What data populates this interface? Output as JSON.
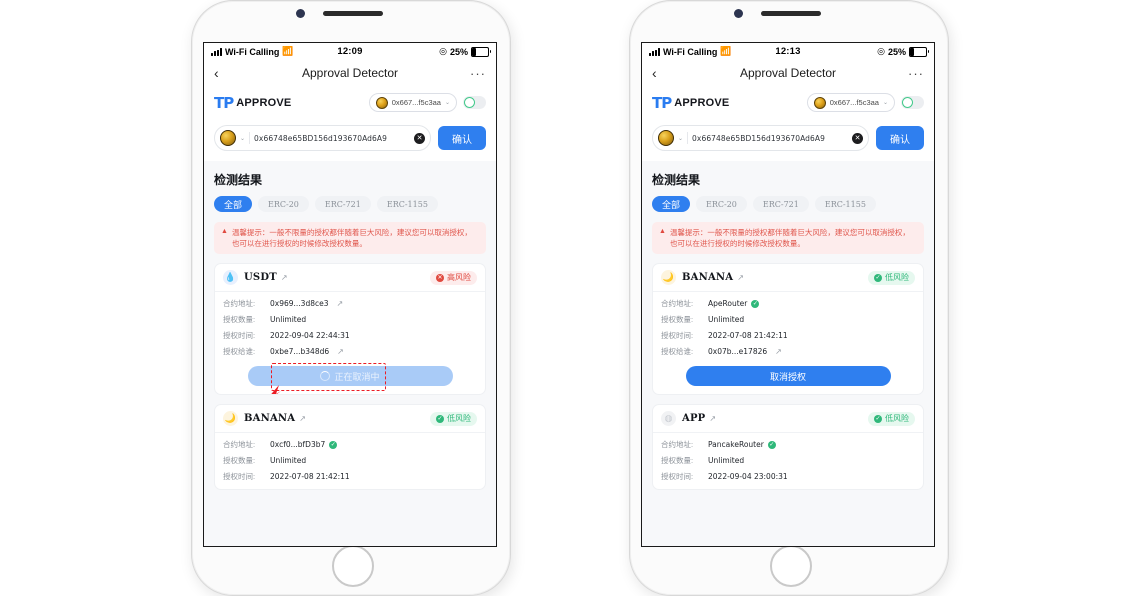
{
  "phones": [
    {
      "id": "left",
      "status": {
        "carrier": "Wi-Fi Calling",
        "time": "12:09",
        "battery": "25%"
      },
      "nav": {
        "back": "‹",
        "title": "Approval Detector",
        "more": "···"
      },
      "dapp": {
        "logo_mark": "TP",
        "logo_word": "APPROVE",
        "address_chip": "0x667...f5c3aa",
        "chevron": "⌄"
      },
      "address_bar": {
        "value": "0x66748e65BD156d193670Ad6A9",
        "clear": "✕",
        "confirm": "确认"
      },
      "section_title": "检测结果",
      "tabs": [
        {
          "label": "全部",
          "active": true
        },
        {
          "label": "ERC-20",
          "active": false
        },
        {
          "label": "ERC-721",
          "active": false
        },
        {
          "label": "ERC-1155",
          "active": false
        }
      ],
      "warning": {
        "icon": "▲",
        "text": "温馨提示：一般不限量的授权都伴随着巨大风险，建议您可以取消授权，也可以在进行授权的时候修改授权数量。"
      },
      "cards": [
        {
          "token": "USDT",
          "icon_class": "tok-usdt",
          "icon_glyph": "💧",
          "link": "↗",
          "risk_label": "高风险",
          "risk_class": "risk-high",
          "risk_glyph": "✕",
          "rows": [
            {
              "key": "合约地址:",
              "value": "0x969...3d8ce3",
              "link": "↗",
              "verified": false
            },
            {
              "key": "授权数量:",
              "value": "Unlimited",
              "link": "",
              "verified": false
            },
            {
              "key": "授权时间:",
              "value": "2022-09-04 22:44:31",
              "link": "",
              "verified": false
            },
            {
              "key": "授权给谁:",
              "value": "0xbe7...b348d6",
              "link": "↗",
              "verified": false
            }
          ],
          "action": {
            "label": "正在取消中",
            "state": "pending",
            "spinner": true,
            "highlight": true
          }
        },
        {
          "token": "BANANA",
          "icon_class": "tok-banana",
          "icon_glyph": "🌙",
          "link": "↗",
          "risk_label": "低风险",
          "risk_class": "risk-low",
          "risk_glyph": "✓",
          "rows": [
            {
              "key": "合约地址:",
              "value": "0xcf0...bfD3b7",
              "link": "",
              "verified": true
            },
            {
              "key": "授权数量:",
              "value": "Unlimited",
              "link": "",
              "verified": false
            },
            {
              "key": "授权时间:",
              "value": "2022-07-08 21:42:11",
              "link": "",
              "verified": false
            }
          ],
          "action": null
        }
      ]
    },
    {
      "id": "right",
      "status": {
        "carrier": "Wi-Fi Calling",
        "time": "12:13",
        "battery": "25%"
      },
      "nav": {
        "back": "‹",
        "title": "Approval Detector",
        "more": "···"
      },
      "dapp": {
        "logo_mark": "TP",
        "logo_word": "APPROVE",
        "address_chip": "0x667...f5c3aa",
        "chevron": "⌄"
      },
      "address_bar": {
        "value": "0x66748e65BD156d193670Ad6A9",
        "clear": "✕",
        "confirm": "确认"
      },
      "section_title": "检测结果",
      "tabs": [
        {
          "label": "全部",
          "active": true
        },
        {
          "label": "ERC-20",
          "active": false
        },
        {
          "label": "ERC-721",
          "active": false
        },
        {
          "label": "ERC-1155",
          "active": false
        }
      ],
      "warning": {
        "icon": "▲",
        "text": "温馨提示：一般不限量的授权都伴随着巨大风险，建议您可以取消授权，也可以在进行授权的时候修改授权数量。"
      },
      "cards": [
        {
          "token": "BANANA",
          "icon_class": "tok-banana",
          "icon_glyph": "🌙",
          "link": "↗",
          "risk_label": "低风险",
          "risk_class": "risk-low",
          "risk_glyph": "✓",
          "rows": [
            {
              "key": "合约地址:",
              "value": "ApeRouter",
              "link": "",
              "verified": true
            },
            {
              "key": "授权数量:",
              "value": "Unlimited",
              "link": "",
              "verified": false
            },
            {
              "key": "授权时间:",
              "value": "2022-07-08 21:42:11",
              "link": "",
              "verified": false
            },
            {
              "key": "授权给谁:",
              "value": "0x07b...e17826",
              "link": "↗",
              "verified": false
            }
          ],
          "action": {
            "label": "取消授权",
            "state": "cancel",
            "spinner": false,
            "highlight": false
          }
        },
        {
          "token": "APP",
          "icon_class": "tok-app",
          "icon_glyph": "◍",
          "link": "↗",
          "risk_label": "低风险",
          "risk_class": "risk-low",
          "risk_glyph": "✓",
          "rows": [
            {
              "key": "合约地址:",
              "value": "PancakeRouter",
              "link": "",
              "verified": true
            },
            {
              "key": "授权数量:",
              "value": "Unlimited",
              "link": "",
              "verified": false
            },
            {
              "key": "授权时间:",
              "value": "2022-09-04 23:00:31",
              "link": "",
              "verified": false
            }
          ],
          "action": null
        }
      ]
    }
  ],
  "colors": {
    "accent": "#2f7fef",
    "risk_high": "#e0493f",
    "risk_low": "#2fb87a",
    "warn_bg": "#fdecec",
    "screen_bg": "#f7f8fa",
    "annotation": "#ec1c24"
  }
}
